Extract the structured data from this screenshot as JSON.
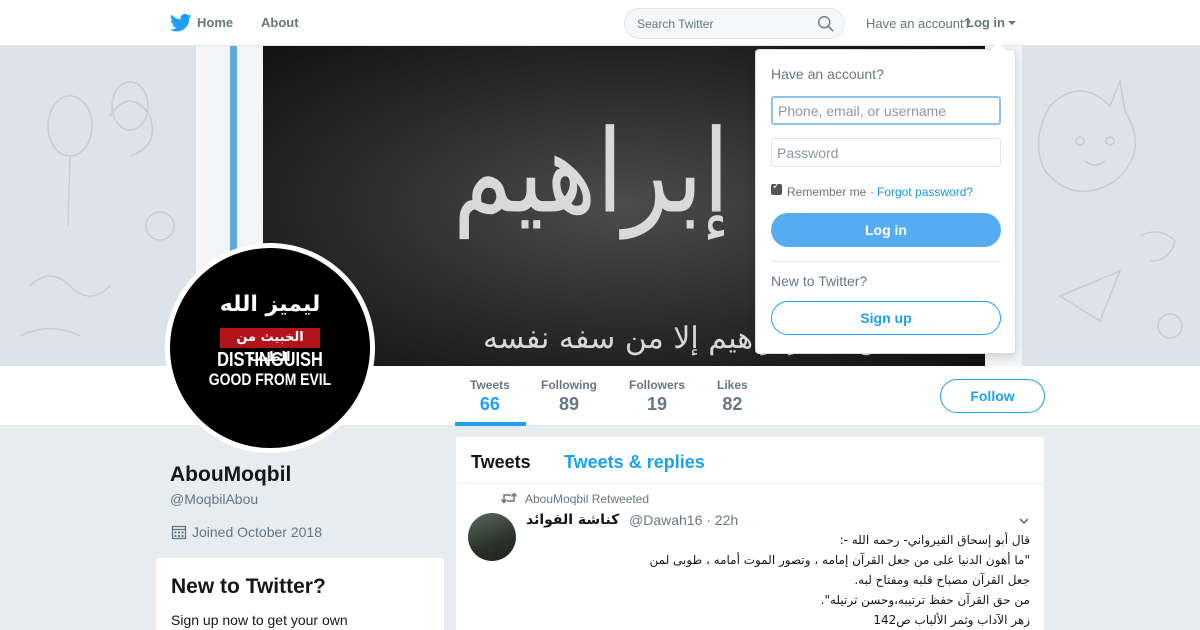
{
  "nav": {
    "home_label": "Home",
    "about_label": "About",
    "search_placeholder": "Search Twitter",
    "have_account": "Have an account?",
    "login_label": "Log in",
    "brand_color": "#1da1f2"
  },
  "banner": {
    "calligraphy": "ةِ إبراهيم",
    "subtitle": "عن ملّة إبراهيم إلا من سفه نفسه"
  },
  "avatar": {
    "arabic_top": "ليميز الله",
    "arabic_bar": "الخبيث من الطيب",
    "english_line1": "DISTINGUISH",
    "english_line2": "GOOD FROM EVIL"
  },
  "profile": {
    "display_name": "AbouMoqbil",
    "handle": "@MoqbilAbou",
    "joined": "Joined October 2018",
    "follow_label": "Follow"
  },
  "stats": [
    {
      "label": "Tweets",
      "value": "66"
    },
    {
      "label": "Following",
      "value": "89"
    },
    {
      "label": "Followers",
      "value": "19"
    },
    {
      "label": "Likes",
      "value": "82"
    }
  ],
  "new_box": {
    "title": "New to Twitter?",
    "text": "Sign up now to get your own personalized timeline!"
  },
  "timeline": {
    "tab_tweets": "Tweets",
    "tab_replies": "Tweets & replies",
    "retweet_text": "AbouMoqbil Retweeted",
    "tweet": {
      "author": "كناشة الفوائد",
      "handle_time": "@Dawah16 · 22h",
      "lines": [
        "قال أبو إسحاق القيرواني- رحمه الله -:",
        "\"ما أهون الدنيا على من جعل القرآن إمامه ، وتصور الموت أمامه ، طوبى لمن",
        "جعل القرآن مصباح قلبه ومفتاح لبه.",
        "من حق القرآن حفظ ترتيبه،وحسن ترتيله\".",
        "زهر الآداب وثمر الألباب ص142"
      ]
    }
  },
  "login_dropdown": {
    "title": "Have an account?",
    "username_placeholder": "Phone, email, or username",
    "password_placeholder": "Password",
    "remember_label": "Remember me",
    "separator": "·",
    "forgot_label": "Forgot password?",
    "login_button": "Log in",
    "new_label": "New to Twitter?",
    "signup_button": "Sign up"
  }
}
